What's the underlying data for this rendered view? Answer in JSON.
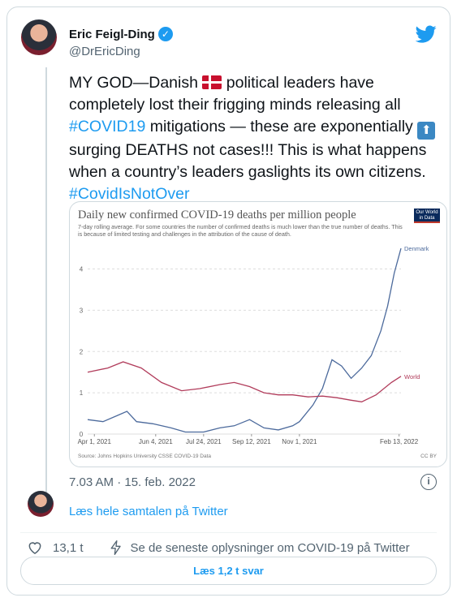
{
  "author": {
    "name": "Eric Feigl-Ding",
    "handle": "@DrEricDing",
    "verified": true
  },
  "tweet": {
    "text_before_flag": "MY GOD—Danish ",
    "text_after_flag": " political leaders have completely lost their frigging minds releasing all ",
    "hashtag1": "#COVID19",
    "text_middle": " mitigations — these are exponentially ",
    "text_after_arrow": " surging DEATHS not cases!!! This is what happens when a country’s leaders gaslights its own citizens. ",
    "hashtag2": "#CovidIsNotOver",
    "timestamp": "7.03 AM · 15. feb. 2022"
  },
  "icons": {
    "brand": "twitter-bird-icon",
    "verified": "verified-badge-icon",
    "flag": "denmark-flag-icon",
    "arrow": "up-arrow-icon",
    "info": "info-icon",
    "like": "heart-icon",
    "news": "lightning-icon"
  },
  "colors": {
    "accent": "#1d9bf0",
    "denmark_line": "#4c6a9c",
    "world_line": "#b13c5b"
  },
  "chart_data": {
    "type": "line",
    "title": "Daily new confirmed COVID-19 deaths per million people",
    "subtitle": "7-day rolling average. For some countries the number of confirmed deaths is much lower than the true number of deaths. This is because of limited testing and challenges in the attribution of the cause of death.",
    "logo_text": "Our World in Data",
    "source": "Source: Johns Hopkins University CSSE COVID-19 Data",
    "license": "CC BY",
    "x_tick_labels": [
      "Apr 1, 2021",
      "Jun 4, 2021",
      "Jul 24, 2021",
      "Sep 12, 2021",
      "Nov 1, 2021",
      "Feb 13, 2022"
    ],
    "x_ticks": [
      "2021-04-01",
      "2021-06-04",
      "2021-07-24",
      "2021-09-12",
      "2021-11-01",
      "2022-02-13"
    ],
    "x_range": [
      "2021-03-25",
      "2022-02-15"
    ],
    "y_ticks": [
      0,
      1,
      2,
      3,
      4
    ],
    "ylim": [
      0,
      4.6
    ],
    "grid": "horizontal",
    "series": [
      {
        "name": "Denmark",
        "points": [
          [
            "2021-03-25",
            0.35
          ],
          [
            "2021-04-10",
            0.3
          ],
          [
            "2021-04-25",
            0.45
          ],
          [
            "2021-05-05",
            0.55
          ],
          [
            "2021-05-15",
            0.3
          ],
          [
            "2021-06-01",
            0.25
          ],
          [
            "2021-06-20",
            0.15
          ],
          [
            "2021-07-05",
            0.05
          ],
          [
            "2021-07-24",
            0.05
          ],
          [
            "2021-08-10",
            0.15
          ],
          [
            "2021-08-25",
            0.2
          ],
          [
            "2021-09-10",
            0.35
          ],
          [
            "2021-09-25",
            0.15
          ],
          [
            "2021-10-10",
            0.1
          ],
          [
            "2021-10-25",
            0.2
          ],
          [
            "2021-11-01",
            0.3
          ],
          [
            "2021-11-15",
            0.7
          ],
          [
            "2021-11-25",
            1.1
          ],
          [
            "2021-12-05",
            1.8
          ],
          [
            "2021-12-15",
            1.65
          ],
          [
            "2021-12-25",
            1.35
          ],
          [
            "2022-01-05",
            1.6
          ],
          [
            "2022-01-15",
            1.9
          ],
          [
            "2022-01-25",
            2.5
          ],
          [
            "2022-02-01",
            3.1
          ],
          [
            "2022-02-08",
            3.9
          ],
          [
            "2022-02-15",
            4.5
          ]
        ]
      },
      {
        "name": "World",
        "points": [
          [
            "2021-03-25",
            1.5
          ],
          [
            "2021-04-15",
            1.6
          ],
          [
            "2021-05-01",
            1.75
          ],
          [
            "2021-05-20",
            1.6
          ],
          [
            "2021-06-10",
            1.25
          ],
          [
            "2021-07-01",
            1.05
          ],
          [
            "2021-07-20",
            1.1
          ],
          [
            "2021-08-10",
            1.2
          ],
          [
            "2021-08-25",
            1.25
          ],
          [
            "2021-09-10",
            1.15
          ],
          [
            "2021-09-25",
            1.0
          ],
          [
            "2021-10-10",
            0.95
          ],
          [
            "2021-10-25",
            0.95
          ],
          [
            "2021-11-10",
            0.9
          ],
          [
            "2021-11-25",
            0.92
          ],
          [
            "2021-12-10",
            0.88
          ],
          [
            "2021-12-25",
            0.82
          ],
          [
            "2022-01-05",
            0.78
          ],
          [
            "2022-01-20",
            0.95
          ],
          [
            "2022-02-05",
            1.25
          ],
          [
            "2022-02-15",
            1.4
          ]
        ]
      }
    ]
  },
  "conversation": {
    "read_label": "Læs hele samtalen på Twitter"
  },
  "actions": {
    "likes": "13,1 t",
    "news_label": "Se de seneste oplysninger om COVID-19 på Twitter",
    "replies_button": "Læs 1,2 t svar"
  }
}
